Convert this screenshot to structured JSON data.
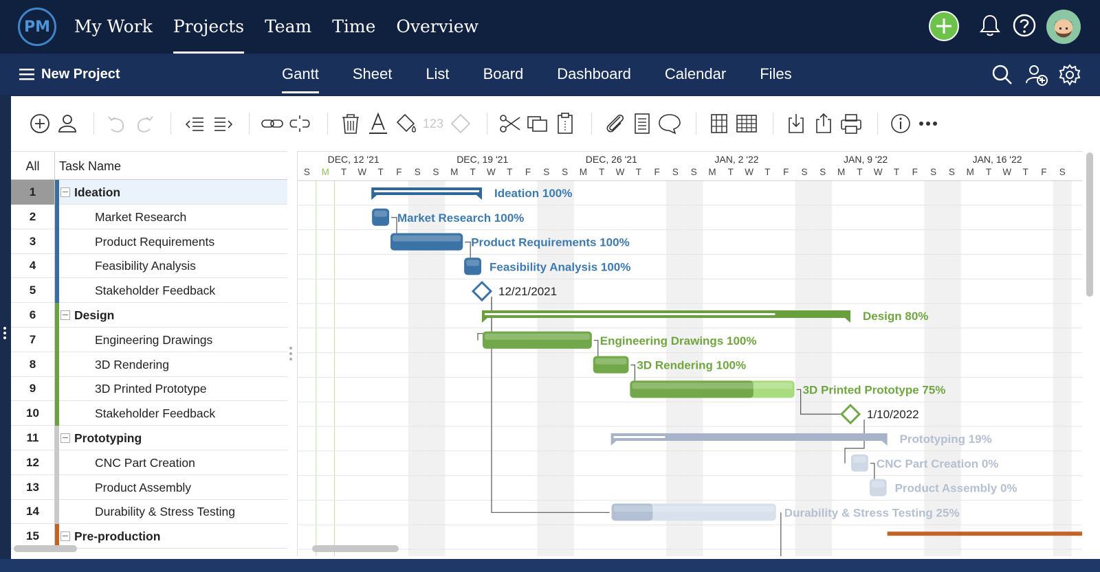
{
  "app": {
    "logo_text": "PM"
  },
  "top_nav": [
    {
      "label": "My Work",
      "active": false
    },
    {
      "label": "Projects",
      "active": true
    },
    {
      "label": "Team",
      "active": false
    },
    {
      "label": "Time",
      "active": false
    },
    {
      "label": "Overview",
      "active": false
    }
  ],
  "top_icons": [
    "add-icon",
    "bell-icon",
    "help-icon",
    "avatar"
  ],
  "subbar": {
    "project_title": "New Project",
    "tabs": [
      {
        "label": "Gantt",
        "active": true
      },
      {
        "label": "Sheet",
        "active": false
      },
      {
        "label": "List",
        "active": false
      },
      {
        "label": "Board",
        "active": false
      },
      {
        "label": "Dashboard",
        "active": false
      },
      {
        "label": "Calendar",
        "active": false
      },
      {
        "label": "Files",
        "active": false
      }
    ]
  },
  "toolbar": {
    "number_format_label": "123",
    "icons": [
      "add-task-icon",
      "assign-user-icon",
      "undo-icon",
      "redo-icon",
      "outdent-icon",
      "indent-icon",
      "link-icon",
      "unlink-icon",
      "delete-icon",
      "font-color-icon",
      "fill-color-icon",
      "number-format-icon",
      "milestone-icon",
      "cut-icon",
      "copy-icon",
      "paste-icon",
      "attachment-icon",
      "notes-icon",
      "comment-icon",
      "columns-icon",
      "grid-icon",
      "import-icon",
      "export-icon",
      "print-icon",
      "info-icon",
      "more-icon"
    ]
  },
  "grid": {
    "all_label": "All",
    "task_name_header": "Task Name",
    "rows": [
      {
        "num": "1",
        "name": "Ideation",
        "summary": true,
        "color": "#3a6e9e"
      },
      {
        "num": "2",
        "name": "Market Research",
        "summary": false,
        "color": "#3a6e9e"
      },
      {
        "num": "3",
        "name": "Product Requirements",
        "summary": false,
        "color": "#3a6e9e"
      },
      {
        "num": "4",
        "name": "Feasibility Analysis",
        "summary": false,
        "color": "#3a6e9e"
      },
      {
        "num": "5",
        "name": "Stakeholder Feedback",
        "summary": false,
        "color": "#3a6e9e"
      },
      {
        "num": "6",
        "name": "Design",
        "summary": true,
        "color": "#6da244"
      },
      {
        "num": "7",
        "name": "Engineering Drawings",
        "summary": false,
        "color": "#6da244"
      },
      {
        "num": "8",
        "name": "3D Rendering",
        "summary": false,
        "color": "#6da244"
      },
      {
        "num": "9",
        "name": "3D Printed Prototype",
        "summary": false,
        "color": "#6da244"
      },
      {
        "num": "10",
        "name": "Stakeholder Feedback",
        "summary": false,
        "color": "#6da244"
      },
      {
        "num": "11",
        "name": "Prototyping",
        "summary": true,
        "color": "#c9c9c9"
      },
      {
        "num": "12",
        "name": "CNC Part Creation",
        "summary": false,
        "color": "#c9c9c9"
      },
      {
        "num": "13",
        "name": "Product Assembly",
        "summary": false,
        "color": "#c9c9c9"
      },
      {
        "num": "14",
        "name": "Durability & Stress Testing",
        "summary": false,
        "color": "#c9c9c9"
      },
      {
        "num": "15",
        "name": "Pre-production",
        "summary": true,
        "color": "#c0642a"
      }
    ]
  },
  "gantt": {
    "week_headers": [
      {
        "label": "DEC, 12 '21",
        "day_index": 2
      },
      {
        "label": "DEC, 19 '21",
        "day_index": 9
      },
      {
        "label": "DEC, 26 '21",
        "day_index": 16
      },
      {
        "label": "JAN, 2 '22",
        "day_index": 23
      },
      {
        "label": "JAN, 9 '22",
        "day_index": 30
      },
      {
        "label": "JAN, 16 '22",
        "day_index": 37
      }
    ],
    "day_letters": [
      "S",
      "M",
      "T",
      "W",
      "T",
      "F",
      "S",
      "S",
      "M",
      "T",
      "W",
      "T",
      "F",
      "S",
      "S",
      "M",
      "T",
      "W",
      "T",
      "F",
      "S",
      "S",
      "M",
      "T",
      "W",
      "T",
      "F",
      "S",
      "S",
      "M",
      "T",
      "W",
      "T",
      "F",
      "S",
      "S",
      "M",
      "T",
      "W",
      "T",
      "F",
      "S"
    ],
    "today_index": 1,
    "weekend_indices": [
      6,
      7,
      13,
      14,
      20,
      21,
      27,
      28,
      34,
      35,
      41
    ],
    "tasks": [
      {
        "row": 0,
        "type": "summary",
        "start": 4,
        "end": 10,
        "progress": 100,
        "color": "#2f6898",
        "label": "Ideation",
        "pct": "100%",
        "label_color": "#3d7ab0"
      },
      {
        "row": 1,
        "type": "task",
        "start": 4,
        "end": 5,
        "progress": 100,
        "color": "#3b73a6",
        "light": "#6d9ac4",
        "label": "Market Research",
        "pct": "100%",
        "label_color": "#3d7ab0"
      },
      {
        "row": 2,
        "type": "task",
        "start": 5,
        "end": 9,
        "progress": 100,
        "color": "#3b73a6",
        "light": "#6d9ac4",
        "label": "Product Requirements",
        "pct": "100%",
        "label_color": "#3d7ab0"
      },
      {
        "row": 3,
        "type": "task",
        "start": 9,
        "end": 10,
        "progress": 100,
        "color": "#3b73a6",
        "light": "#6d9ac4",
        "label": "Feasibility Analysis",
        "pct": "100%",
        "label_color": "#3d7ab0"
      },
      {
        "row": 4,
        "type": "milestone",
        "at": 10,
        "color": "#3b73a6",
        "date": "12/21/2021"
      },
      {
        "row": 5,
        "type": "summary",
        "start": 10,
        "end": 30,
        "progress": 80,
        "color": "#6a9f3e",
        "label": "Design",
        "pct": "80%",
        "label_color": "#6fa63f"
      },
      {
        "row": 6,
        "type": "task",
        "start": 10,
        "end": 16,
        "progress": 100,
        "color": "#72a84a",
        "light": "#9cc97a",
        "label": "Engineering Drawings",
        "pct": "100%",
        "label_color": "#6fa63f"
      },
      {
        "row": 7,
        "type": "task",
        "start": 16,
        "end": 18,
        "progress": 100,
        "color": "#72a84a",
        "light": "#9cc97a",
        "label": "3D Rendering",
        "pct": "100%",
        "label_color": "#6fa63f"
      },
      {
        "row": 8,
        "type": "task",
        "start": 18,
        "end": 27,
        "progress": 75,
        "color": "#72a84a",
        "light": "#a8dc7e",
        "label": "3D Printed Prototype",
        "pct": "75%",
        "label_color": "#6fa63f"
      },
      {
        "row": 9,
        "type": "milestone",
        "at": 30,
        "color": "#72a84a",
        "date": "1/10/2022"
      },
      {
        "row": 10,
        "type": "summary",
        "start": 17,
        "end": 32,
        "progress": 19,
        "color": "#a7b3c8",
        "label": "Prototyping",
        "pct": "19%",
        "label_color": "#b4bfd0"
      },
      {
        "row": 11,
        "type": "task",
        "start": 30,
        "end": 31,
        "progress": 0,
        "color": "#a9b8cc",
        "light": "#cfd9e6",
        "label": "CNC Part Creation",
        "pct": "0%",
        "label_color": "#b4bfd0"
      },
      {
        "row": 12,
        "type": "task",
        "start": 31,
        "end": 32,
        "progress": 0,
        "color": "#a9b8cc",
        "light": "#cfd9e6",
        "label": "Product Assembly",
        "pct": "0%",
        "label_color": "#b4bfd0"
      },
      {
        "row": 13,
        "type": "task",
        "start": 17,
        "end": 26,
        "progress": 25,
        "color": "#b3c0d3",
        "light": "#d8e1ec",
        "label": "Durability & Stress Testing",
        "pct": "25%",
        "label_color": "#b4bfd0"
      },
      {
        "row": 14,
        "type": "summary_partial",
        "start": 32,
        "end": 42,
        "color": "#c0642a"
      }
    ]
  }
}
